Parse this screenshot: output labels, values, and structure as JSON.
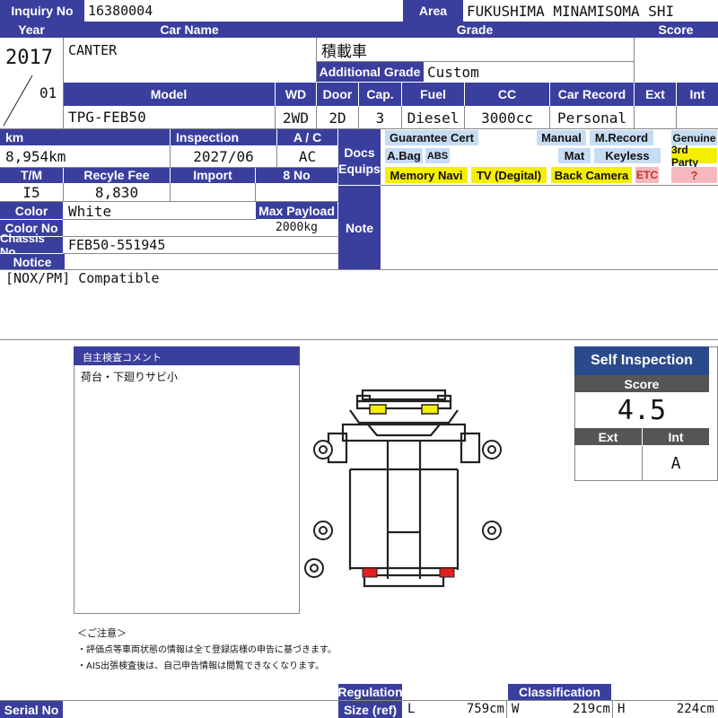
{
  "header": {
    "inquiry_label": "Inquiry No",
    "inquiry_value": "16380004",
    "area_label": "Area",
    "area_value": "FUKUSHIMA MINAMISOMA SHI"
  },
  "labels": {
    "year": "Year",
    "car_name": "Car Name",
    "grade": "Grade",
    "score": "Score",
    "additional_grade": "Additional Grade",
    "model": "Model",
    "wd": "WD",
    "door": "Door",
    "cap": "Cap.",
    "fuel": "Fuel",
    "cc": "CC",
    "car_record": "Car Record",
    "ext": "Ext",
    "int": "Int",
    "km": "km",
    "inspection": "Inspection",
    "ac": "A / C",
    "docs": "Docs",
    "equips": "Equips",
    "tm": "T/M",
    "recycle_fee": "Recyle Fee",
    "import": "Import",
    "no8": "8 No",
    "color": "Color",
    "max_payload": "Max Payload",
    "color_no": "Color No",
    "chassis_no": "Chassis No",
    "notice": "Notice",
    "note": "Note",
    "serial_no": "Serial No",
    "regulation": "Regulation",
    "size_ref": "Size (ref)",
    "classification": "Classification"
  },
  "values": {
    "year": "2017",
    "month": "01",
    "car_name": "CANTER",
    "grade": "積載車",
    "additional_grade": "Custom",
    "model": "TPG-FEB50",
    "wd": "2WD",
    "door": "2D",
    "cap": "3",
    "fuel": "Diesel",
    "cc": "3000cc",
    "car_record": "Personal",
    "km": "8,954km",
    "inspection": "2027/06",
    "ac": "AC",
    "tm": "I5",
    "recycle_fee": "8,830",
    "color": "White",
    "max_payload": "2000kg",
    "chassis_no": "FEB50-551945",
    "notice": "[NOX/PM] Compatible"
  },
  "equips": {
    "guarantee_cert": "Guarantee Cert",
    "manual": "Manual",
    "m_record": "M.Record",
    "genuine": "Genuine",
    "a_bag": "A.Bag",
    "abs": "ABS",
    "mat": "Mat",
    "keyless": "Keyless",
    "third_party": "3rd Party",
    "memory_navi": "Memory Navi",
    "tv": "TV (Degital)",
    "back_camera": "Back Camera",
    "etc": "ETC",
    "question": "?"
  },
  "comment": {
    "title": "自主検査コメント",
    "text": "荷台・下廻りサビ小"
  },
  "self_inspection": {
    "title": "Self Inspection",
    "score_label": "Score",
    "score": "4.5",
    "ext_label": "Ext",
    "int_label": "Int",
    "ext": "",
    "int": "A"
  },
  "notes": {
    "title": "＜ご注意＞",
    "line1": "・評価点等車両状態の情報は全て登録店様の申告に基づきます。",
    "line2": "・AIS出張検査後は、自己申告情報は閲覧できなくなります。"
  },
  "size": {
    "l_label": "L",
    "l": "759cm",
    "w_label": "W",
    "w": "219cm",
    "h_label": "H",
    "h": "224cm"
  },
  "colors": {
    "header": "#3a3f9e",
    "equip_blue": "#c6dcf3",
    "equip_yellow": "#f4ee00",
    "equip_pink": "#f5b8bd",
    "self_title": "#2b4a8b",
    "self_sub": "#555555"
  }
}
